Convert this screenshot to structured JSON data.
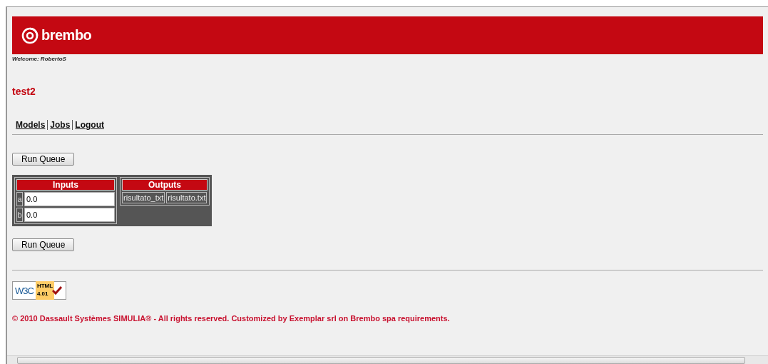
{
  "header": {
    "logo_text": "brembo"
  },
  "welcome": "Welcome: RobertoS",
  "title": "test2",
  "nav": [
    {
      "label": "Models"
    },
    {
      "label": "Jobs"
    },
    {
      "label": "Logout"
    }
  ],
  "run_button": "Run Queue",
  "inputs": {
    "heading": "Inputs",
    "rows": [
      {
        "label": "a",
        "value": "0.0"
      },
      {
        "label": "b",
        "value": "0.0"
      }
    ]
  },
  "outputs": {
    "heading": "Outputs",
    "cells": [
      "risultato_txt",
      "risultato.txt"
    ]
  },
  "run_button_bottom": "Run Queue",
  "badge": {
    "w3c": "W3C",
    "html": "HTML",
    "version": "4.01"
  },
  "footer": "© 2010 Dassault Systèmes SIMULIA® - All rights reserved. Customized by Exemplar srl on Brembo spa requirements."
}
